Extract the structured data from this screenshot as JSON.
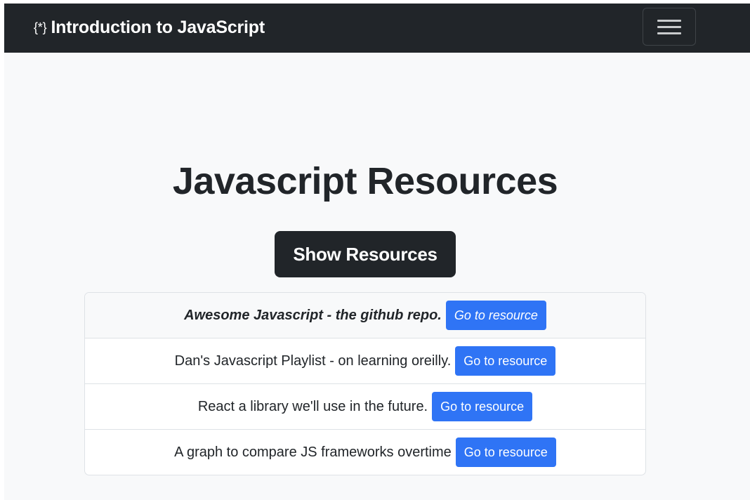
{
  "navbar": {
    "brand_icon": "{*}",
    "brand_title": "Introduction to JavaScript",
    "menu_icon": "hamburger-menu-icon"
  },
  "main": {
    "heading": "Javascript Resources",
    "show_button_label": "Show Resources",
    "resources": [
      {
        "label": "Awesome Javascript - the github repo.",
        "button": "Go to resource",
        "active": true
      },
      {
        "label": "Dan's Javascript Playlist - on learning oreilly.",
        "button": "Go to resource",
        "active": false
      },
      {
        "label": "React a library we'll use in the future.",
        "button": "Go to resource",
        "active": false
      },
      {
        "label": "A graph to compare JS frameworks overtime",
        "button": "Go to resource",
        "active": false
      }
    ]
  },
  "colors": {
    "navbar_bg": "#212529",
    "page_bg": "#f8f9fa",
    "primary_button": "#2f74f5"
  }
}
